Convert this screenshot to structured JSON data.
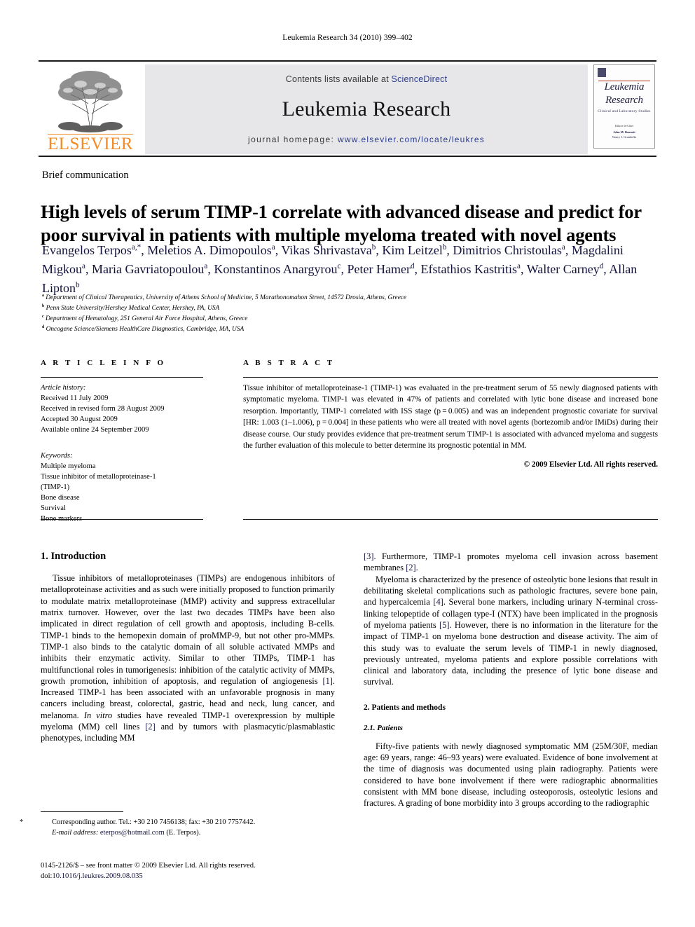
{
  "running_head": "Leukemia Research 34 (2010) 399–402",
  "masthead": {
    "publisher_wordmark": "ELSEVIER",
    "contents_prefix": "Contents lists available at ",
    "contents_link": "ScienceDirect",
    "journal_title": "Leukemia Research",
    "homepage_prefix": "journal homepage: ",
    "homepage_url": "www.elsevier.com/locate/leukres",
    "cover": {
      "line1": "Leukemia",
      "line2": "Research",
      "subtitle": "Clinical and Laboratory Studies",
      "editors_label": "Editors-in-Chief",
      "editor_1": "John M. Bennett",
      "editor_2": "Nancy J. Grandolfo"
    }
  },
  "article": {
    "type": "Brief communication",
    "title": "High levels of serum TIMP-1 correlate with advanced disease and predict for poor survival in patients with multiple myeloma treated with novel agents",
    "authors_line1": "Evangelos Terpos",
    "authors": [
      {
        "name": "Evangelos Terpos",
        "sup": "a,*"
      },
      {
        "name": "Meletios A. Dimopoulos",
        "sup": "a"
      },
      {
        "name": "Vikas Shrivastava",
        "sup": "b"
      },
      {
        "name": "Kim Leitzel",
        "sup": "b"
      },
      {
        "name": "Dimitrios Christoulas",
        "sup": "a"
      },
      {
        "name": "Magdalini Migkou",
        "sup": "a"
      },
      {
        "name": "Maria Gavriatopoulou",
        "sup": "a"
      },
      {
        "name": "Konstantinos Anargyrou",
        "sup": "c"
      },
      {
        "name": "Peter Hamer",
        "sup": "d"
      },
      {
        "name": "Efstathios Kastritis",
        "sup": "a"
      },
      {
        "name": "Walter Carney",
        "sup": "d"
      },
      {
        "name": "Allan Lipton",
        "sup": "b"
      }
    ],
    "affiliations": [
      {
        "sup": "a",
        "text": "Department of Clinical Therapeutics, University of Athens School of Medicine, 5 Marathonomahon Street, 14572 Drosia, Athens, Greece"
      },
      {
        "sup": "b",
        "text": "Penn State University/Hershey Medical Center, Hershey, PA, USA"
      },
      {
        "sup": "c",
        "text": "Department of Hematology, 251 General Air Force Hospital, Athens, Greece"
      },
      {
        "sup": "d",
        "text": "Oncogene Science/Siemens HealthCare Diagnostics, Cambridge, MA, USA"
      }
    ]
  },
  "article_info": {
    "heading": "A R T I C L E   I N F O",
    "history_label": "Article history:",
    "history": [
      "Received 11 July 2009",
      "Received in revised form 28 August 2009",
      "Accepted 30 August 2009",
      "Available online 24 September 2009"
    ],
    "keywords_label": "Keywords:",
    "keywords": [
      "Multiple myeloma",
      "Tissue inhibitor of metalloproteinase-1",
      "(TIMP-1)",
      "Bone disease",
      "Survival",
      "Bone markers"
    ]
  },
  "abstract": {
    "heading": "A B S T R A C T",
    "text": "Tissue inhibitor of metalloproteinase-1 (TIMP-1) was evaluated in the pre-treatment serum of 55 newly diagnosed patients with symptomatic myeloma. TIMP-1 was elevated in 47% of patients and correlated with lytic bone disease and increased bone resorption. Importantly, TIMP-1 correlated with ISS stage (p = 0.005) and was an independent prognostic covariate for survival [HR: 1.003 (1–1.006), p = 0.004] in these patients who were all treated with novel agents (bortezomib and/or IMiDs) during their disease course. Our study provides evidence that pre-treatment serum TIMP-1 is associated with advanced myeloma and suggests the further evaluation of this molecule to better determine its prognostic potential in MM.",
    "copyright": "© 2009 Elsevier Ltd. All rights reserved."
  },
  "body": {
    "section1_heading": "1.  Introduction",
    "intro_p1_a": "Tissue inhibitors of metalloproteinases (TIMPs) are endogenous inhibitors of metalloproteinase activities and as such were initially proposed to function primarily to modulate matrix metalloproteinase (MMP) activity and suppress extracellular matrix turnover. However, over the last two decades TIMPs have been also implicated in direct regulation of cell growth and apoptosis, including B-cells. TIMP-1 binds to the hemopexin domain of proMMP-9, but not other pro-MMPs. TIMP-1 also binds to the catalytic domain of all soluble activated MMPs and inhibits their enzymatic activity. Similar to other TIMPs, TIMP-1 has multifunctional roles in tumorigenesis: inhibition of the catalytic activity of MMPs, growth promotion, inhibition of apoptosis, and regulation of angiogenesis ",
    "ref1": "[1]",
    "intro_p1_b": ". Increased TIMP-1 has been associated with an unfavorable prognosis in many cancers including breast, colorectal, gastric, head and neck, lung cancer, and melanoma. ",
    "invitro": "In vitro",
    "intro_p1_c": " studies have revealed TIMP-1 overexpression by multiple myeloma (MM) cell lines ",
    "ref2": "[2]",
    "intro_p1_d": " and by tumors with plasmacytic/plasmablastic phenotypes, including MM ",
    "ref3": "[3]",
    "intro_p1_e": ". Furthermore, TIMP-1 promotes myeloma cell invasion across basement membranes ",
    "ref2b": "[2]",
    "intro_p1_f": ".",
    "intro_p2_a": "Myeloma is characterized by the presence of osteolytic bone lesions that result in debilitating skeletal complications such as pathologic fractures, severe bone pain, and hypercalcemia ",
    "ref4": "[4]",
    "intro_p2_b": ". Several bone markers, including urinary N-terminal cross-linking telopeptide of collagen type-I (NTX) have been implicated in the prognosis of myeloma patients ",
    "ref5": "[5]",
    "intro_p2_c": ". However, there is no information in the literature for the impact of TIMP-1 on myeloma bone destruction and disease activity. The aim of this study was to evaluate the serum levels of TIMP-1 in newly diagnosed, previously untreated, myeloma patients and explore possible correlations with clinical and laboratory data, including the presence of lytic bone disease and survival.",
    "section2_heading": "2.  Patients and methods",
    "section21_heading": "2.1.  Patients",
    "patients_p1": "Fifty-five patients with newly diagnosed symptomatic MM (25M/30F, median age: 69 years, range: 46–93 years) were evaluated. Evidence of bone involvement at the time of diagnosis was documented using plain radiography. Patients were considered to have bone involvement if there were radiographic abnormalities consistent with MM bone disease, including osteoporosis, osteolytic lesions and fractures. A grading of bone morbidity into 3 groups according to the radiographic"
  },
  "footnote": {
    "star": "*",
    "corresponding": "Corresponding author. Tel.: +30 210 7456138; fax: +30 210 7757442.",
    "email_label": "E-mail address:",
    "email": "eterpos@hotmail.com",
    "email_suffix": "(E. Terpos)."
  },
  "imprint": {
    "line1": "0145-2126/$ – see front matter © 2009 Elsevier Ltd. All rights reserved.",
    "doi_label": "doi:",
    "doi": "10.1016/j.leukres.2009.08.035"
  }
}
